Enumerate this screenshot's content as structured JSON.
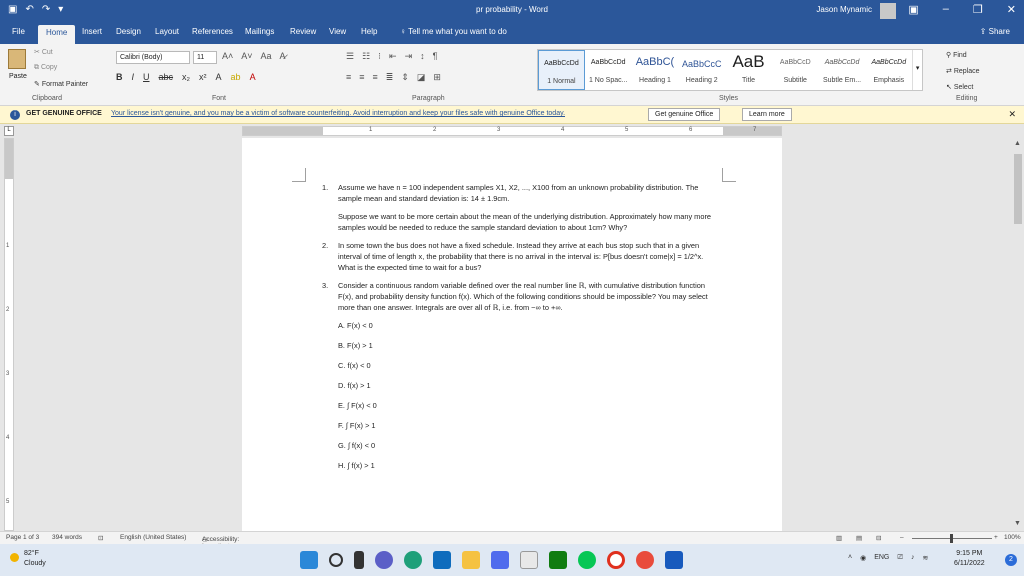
{
  "titlebar": {
    "doc_title": "pr probability  -  Word",
    "user": "Jason Mynamic",
    "quick_access": [
      "save-icon",
      "undo-icon",
      "redo-icon",
      "customize-icon"
    ]
  },
  "tabs": [
    "File",
    "Home",
    "Insert",
    "Design",
    "Layout",
    "References",
    "Mailings",
    "Review",
    "View",
    "Help"
  ],
  "tell_me": "Tell me what you want to do",
  "share": "Share",
  "ribbon": {
    "paste": "Paste",
    "cut": "Cut",
    "copy": "Copy",
    "format_painter": "Format Painter",
    "clipboard": "Clipboard",
    "font_name": "Calibri (Body)",
    "font_size": "11",
    "font_group": "Font",
    "paragraph_group": "Paragraph",
    "styles_group": "Styles",
    "editing_group": "Editing",
    "styles": [
      {
        "sample": "AaBbCcDd",
        "name": "1 Normal"
      },
      {
        "sample": "AaBbCcDd",
        "name": "1 No Spac..."
      },
      {
        "sample": "AaBbC(",
        "name": "Heading 1"
      },
      {
        "sample": "AaBbCcC",
        "name": "Heading 2"
      },
      {
        "sample": "AaB",
        "name": "Title"
      },
      {
        "sample": "AaBbCcD",
        "name": "Subtitle"
      },
      {
        "sample": "AaBbCcDd",
        "name": "Subtle Em..."
      },
      {
        "sample": "AaBbCcDd",
        "name": "Emphasis"
      }
    ],
    "find": "Find",
    "replace": "Replace",
    "select": "Select"
  },
  "license": {
    "head": "GET GENUINE OFFICE",
    "message": "Your license isn't genuine, and you may be a victim of software counterfeiting. Avoid interruption and keep your files safe with genuine Office today.",
    "button1": "Get genuine Office",
    "button2": "Learn more"
  },
  "ruler": {
    "h_numbers": [
      "1",
      "2",
      "3",
      "4",
      "5",
      "6",
      "7"
    ],
    "v_numbers": [
      "1",
      "2",
      "3",
      "4",
      "5"
    ]
  },
  "doc": {
    "q1": {
      "num": "1.",
      "p1": "Assume we have n = 100 independent samples X1, X2, ..., X100 from an unknown probability distribution. The sample mean and standard deviation is: 14 ± 1.9cm.",
      "p2": "Suppose we want to be more certain about the mean of the underlying distribution. Approximately how many more samples would be needed to reduce the sample standard deviation to about 1cm? Why?"
    },
    "q2": {
      "num": "2.",
      "p1": "In some town the bus does not have a fixed schedule. Instead they arrive at each bus stop such that in a given interval of time of length x, the probability that there is no arrival in the interval is: P[bus doesn't come|x] = 1/2^x. What is the expected time to wait for a bus?"
    },
    "q3": {
      "num": "3.",
      "p1": "Consider a continuous random variable defined over the real number line ℝ, with cumulative distribution function F(x), and probability density function f(x). Which of the following conditions should be impossible? You may select more than one answer. Integrals are over all of ℝ, i.e. from −∞ to +∞.",
      "options": [
        "A. F(x) < 0",
        "B. F(x) > 1",
        "C. f(x) < 0",
        "D. f(x) > 1",
        "E. ∫ F(x) < 0",
        "F. ∫ F(x) > 1",
        "G. ∫ f(x) < 0",
        "H. ∫ f(x) > 1"
      ]
    }
  },
  "status": {
    "page": "Page 1 of 3",
    "words": "394 words",
    "language": "English (United States)",
    "accessibility": "Accessibility: Investigate",
    "zoom": "100%"
  },
  "taskbar": {
    "temp": "82°F",
    "weather": "Cloudy",
    "lang": "ENG",
    "time": "9:15 PM",
    "date": "6/11/2022",
    "notifications": "2"
  },
  "colors": {
    "accent": "#2b579a",
    "license_bg": "#fff7d1"
  }
}
